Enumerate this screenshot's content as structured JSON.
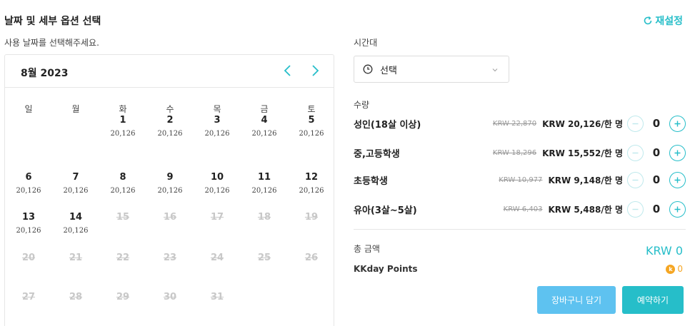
{
  "header": {
    "title": "날짜 및 세부 옵션 선택",
    "reset_label": "재설정"
  },
  "calendar": {
    "hint": "사용 날짜를 선택해주세요.",
    "month": "8월 2023",
    "weekdays": [
      "일",
      "월",
      "화",
      "수",
      "목",
      "금",
      "토"
    ],
    "weeks": [
      [
        null,
        null,
        {
          "d": "1",
          "p": "20,126"
        },
        {
          "d": "2",
          "p": "20,126"
        },
        {
          "d": "3",
          "p": "20,126"
        },
        {
          "d": "4",
          "p": "20,126"
        },
        {
          "d": "5",
          "p": "20,126"
        }
      ],
      [
        {
          "d": "6",
          "p": "20,126"
        },
        {
          "d": "7",
          "p": "20,126"
        },
        {
          "d": "8",
          "p": "20,126"
        },
        {
          "d": "9",
          "p": "20,126"
        },
        {
          "d": "10",
          "p": "20,126"
        },
        {
          "d": "11",
          "p": "20,126"
        },
        {
          "d": "12",
          "p": "20,126"
        }
      ],
      [
        {
          "d": "13",
          "p": "20,126"
        },
        {
          "d": "14",
          "p": "20,126"
        },
        {
          "d": "15",
          "dis": true
        },
        {
          "d": "16",
          "dis": true
        },
        {
          "d": "17",
          "dis": true
        },
        {
          "d": "18",
          "dis": true
        },
        {
          "d": "19",
          "dis": true
        }
      ],
      [
        {
          "d": "20",
          "dis": true
        },
        {
          "d": "21",
          "dis": true
        },
        {
          "d": "22",
          "dis": true
        },
        {
          "d": "23",
          "dis": true
        },
        {
          "d": "24",
          "dis": true
        },
        {
          "d": "25",
          "dis": true
        },
        {
          "d": "26",
          "dis": true
        }
      ],
      [
        {
          "d": "27",
          "dis": true
        },
        {
          "d": "28",
          "dis": true
        },
        {
          "d": "29",
          "dis": true
        },
        {
          "d": "30",
          "dis": true
        },
        {
          "d": "31",
          "dis": true
        },
        null,
        null
      ]
    ]
  },
  "timeslot": {
    "label": "시간대",
    "value": "선택"
  },
  "quantity": {
    "label": "수량",
    "rows": [
      {
        "name": "성인(18살 이상)",
        "old_price": "KRW 22,870",
        "new_price": "KRW 20,126/한 명",
        "qty": "0"
      },
      {
        "name": "중,고등학생",
        "old_price": "KRW 18,296",
        "new_price": "KRW 15,552/한 명",
        "qty": "0"
      },
      {
        "name": "초등학생",
        "old_price": "KRW 10,977",
        "new_price": "KRW 9,148/한 명",
        "qty": "0"
      },
      {
        "name": "유아(3살~5살)",
        "old_price": "KRW 6,403",
        "new_price": "KRW 5,488/한 명",
        "qty": "0"
      }
    ]
  },
  "summary": {
    "total_label": "총 금액",
    "total_value": "KRW 0",
    "points_label": "KKday Points",
    "points_value": "0",
    "coin_glyph": "k"
  },
  "actions": {
    "cart_label": "장바구니 담기",
    "book_label": "예약하기"
  },
  "colors": {
    "accent": "#26bec9",
    "cart_button": "#5ec2f0",
    "points": "#f5a623"
  }
}
